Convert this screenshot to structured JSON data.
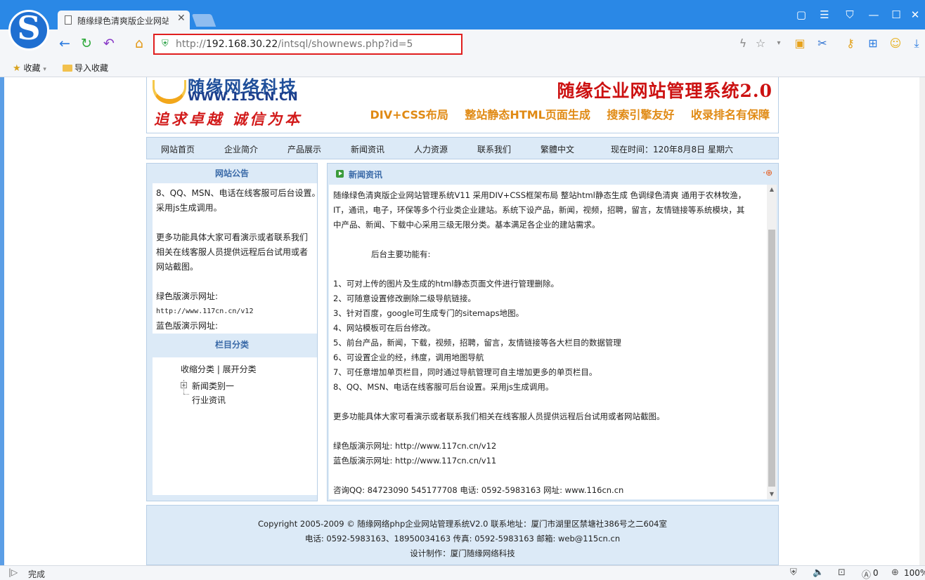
{
  "browser": {
    "tab_title": "随缘绿色清爽版企业网站",
    "address_url_scheme": "http://",
    "address_url_host": "192.168.30.22",
    "address_url_path": "/intsql/shownews.php?id=5",
    "bookmarks": [
      {
        "label": "收藏"
      },
      {
        "label": "导入收藏"
      }
    ],
    "status_text": "完成",
    "status_count": "0",
    "zoom": "100%",
    "accent": "#2a88e6",
    "highlight": "#e01f1f"
  },
  "header": {
    "logo_cn": "随缘网络科技",
    "logo_en": "WWW.115CN.CN",
    "slogan": "追求卓越 诚信为本",
    "system_name": "随缘企业网站管理系统2.0",
    "features": "DIV+CSS布局 整站静态HTML页面生成 搜索引擎友好 收录排名有保障"
  },
  "nav": {
    "items": [
      "网站首页",
      "企业简介",
      "产品展示",
      "新闻资讯",
      "人力资源",
      "联系我们",
      "繁體中文"
    ],
    "time_text": "现在时间：120年8月8日 星期六"
  },
  "notice": {
    "title": "网站公告",
    "lines": [
      "8、QQ、MSN、电话在线客服可后台设置。",
      "采用js生成调用。",
      "",
      "更多功能具体大家可看演示或者联系我们",
      "相关在线客服人员提供远程后台试用或者",
      "网站截图。",
      "",
      "绿色版演示网址:",
      "http://www.117cn.cn/v12",
      "蓝色版演示网址:"
    ]
  },
  "category": {
    "title": "栏目分类",
    "toggle": "收缩分类 | 展开分类",
    "items": [
      "新闻类别一",
      "行业资讯"
    ]
  },
  "article": {
    "title": "新闻资讯",
    "paragraphs": [
      "随缘绿色清爽版企业网站管理系统V11    采用DIV+CSS框架布局 整站html静态生成 色调绿色清爽 通用于农林牧渔，",
      "IT，通讯，电子，环保等多个行业类企业建站。系统下设产品，新闻，视频，招聘，留言，友情链接等系统模块，其",
      "中产品、新闻、下载中心采用三级无限分类。基本满足各企业的建站需求。",
      "",
      "后台主要功能有:",
      "",
      "1、可对上传的图片及生成的html静态页面文件进行管理删除。",
      "2、可随意设置修改删除二级导航链接。",
      "3、针对百度，google可生成专门的sitemaps地图。",
      "4、网站模板可在后台修改。",
      "5、前台产品，新闻，下载，视频，招聘，留言，友情链接等各大栏目的数据管理",
      "6、可设置企业的经，纬度，调用地图导航",
      "7、可任意增加单页栏目，同时通过导航管理可自主增加更多的单页栏目。",
      "8、QQ、MSN、电话在线客服可后台设置。采用js生成调用。",
      "",
      "更多功能具体大家可看演示或者联系我们相关在线客服人员提供远程后台试用或者网站截图。",
      "",
      "绿色版演示网址: http://www.117cn.cn/v12",
      "蓝色版演示网址: http://www.117cn.cn/v11",
      "",
      "咨询QQ: 84723090 545177708 电话: 0592-5983163    网址: www.116cn.cn"
    ]
  },
  "footer": {
    "lines": [
      "Copyright 2005-2009 © 随缘网络php企业网站管理系统V2.0 联系地址：厦门市湖里区禁塘社386号之二604室",
      "电话: 0592-5983163、18950034163 传真: 0592-5983163 邮箱: web@115cn.cn",
      "设计制作：厦门随缘网络科技"
    ]
  }
}
